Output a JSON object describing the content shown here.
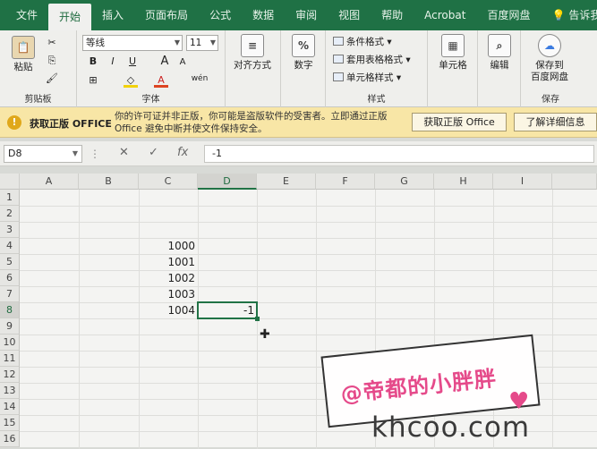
{
  "tabs": [
    "文件",
    "开始",
    "插入",
    "页面布局",
    "公式",
    "数据",
    "审阅",
    "视图",
    "帮助",
    "Acrobat",
    "百度网盘",
    "告诉我"
  ],
  "tab_icon": "lightbulb-icon",
  "ribbon": {
    "clipboard": {
      "paste": "粘贴",
      "label": "剪贴板"
    },
    "font": {
      "name": "等线",
      "size": "11",
      "bold": "B",
      "italic": "I",
      "underline": "U",
      "increase": "A",
      "decrease": "A",
      "label": "字体",
      "phonetic": "wén"
    },
    "alignment": {
      "label": "对齐方式"
    },
    "number": {
      "label": "数字",
      "icon_text": "%"
    },
    "styles": {
      "items": [
        "条件格式",
        "套用表格格式",
        "单元格样式"
      ],
      "label": "样式"
    },
    "cells": {
      "label": "单元格"
    },
    "editing": {
      "label": "编辑"
    },
    "save": {
      "label1": "保存到",
      "label2": "百度网盘",
      "group": "保存"
    }
  },
  "message_bar": {
    "title": "获取正版 OFFICE",
    "text": "你的许可证并非正版，你可能是盗版软件的受害者。立即通过正版 Office 避免中断并使文件保持安全。",
    "button1": "获取正版 Office",
    "button2": "了解详细信息"
  },
  "formula_bar": {
    "name_box": "D8",
    "cancel": "✕",
    "confirm": "✓",
    "fx": "fx",
    "value": "-1"
  },
  "columns": [
    "A",
    "B",
    "C",
    "D",
    "E",
    "F",
    "G",
    "H",
    "I"
  ],
  "rows": [
    "1",
    "2",
    "3",
    "4",
    "5",
    "6",
    "7",
    "8",
    "9",
    "10",
    "11",
    "12",
    "13",
    "14",
    "15",
    "16"
  ],
  "cells": [
    {
      "ref": "C4",
      "value": "1000"
    },
    {
      "ref": "C5",
      "value": "1001"
    },
    {
      "ref": "C6",
      "value": "1002"
    },
    {
      "ref": "C7",
      "value": "1003"
    },
    {
      "ref": "C8",
      "value": "1004"
    },
    {
      "ref": "D8",
      "value": "-1"
    }
  ],
  "selected_cell": "D8",
  "watermark": {
    "text": "@帝都的小胖胖",
    "site": "khcoo.com"
  }
}
